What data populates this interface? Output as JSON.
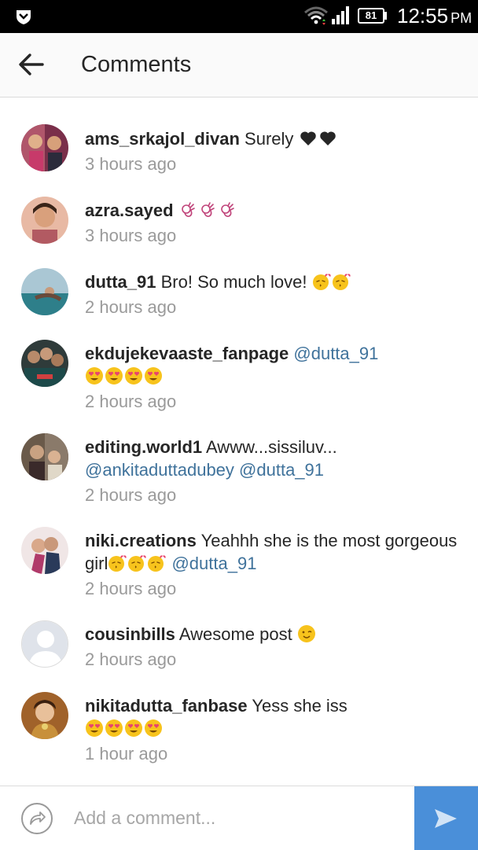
{
  "status_bar": {
    "battery": "81",
    "time": "12:55",
    "ampm": "PM"
  },
  "header": {
    "title": "Comments"
  },
  "comments": [
    {
      "username": "ams_srkajol_divan",
      "text": "Surely",
      "emoji": [
        "heart",
        "heart"
      ],
      "timestamp": "3 hours ago"
    },
    {
      "username": "azra.sayed",
      "text": "",
      "emoji": [
        "ok-hand",
        "ok-hand",
        "ok-hand"
      ],
      "timestamp": "3 hours ago"
    },
    {
      "username": "dutta_91",
      "text": "Bro! So much love!",
      "emoji": [
        "kiss",
        "kiss"
      ],
      "timestamp": "2 hours ago"
    },
    {
      "username": "ekdujekevaaste_fanpage",
      "mention": "@dutta_91",
      "emoji": [
        "heart-eyes",
        "heart-eyes",
        "heart-eyes",
        "heart-eyes"
      ],
      "timestamp": "2 hours ago"
    },
    {
      "username": "editing.world1",
      "text": "Awww...sissiluv...",
      "mention1": "@ankitaduttadubey",
      "mention2": "@dutta_91",
      "timestamp": "2 hours ago"
    },
    {
      "username": "niki.creations",
      "text": "Yeahhh she is the most gorgeous girl",
      "emoji": [
        "kiss",
        "kiss",
        "kiss"
      ],
      "mention": "@dutta_91",
      "timestamp": "2 hours ago"
    },
    {
      "username": "cousinbills",
      "text": "Awesome post",
      "emoji": [
        "wink"
      ],
      "timestamp": "2 hours ago"
    },
    {
      "username": "nikitadutta_fanbase",
      "text": "Yess she iss",
      "emoji": [
        "heart-eyes",
        "heart-eyes",
        "heart-eyes",
        "heart-eyes"
      ],
      "timestamp": "1 hour ago"
    }
  ],
  "composer": {
    "placeholder": "Add a comment..."
  },
  "colors": {
    "mention": "#3f729b",
    "send_button": "#4a8fd9",
    "timestamp": "#9a9a9a"
  }
}
